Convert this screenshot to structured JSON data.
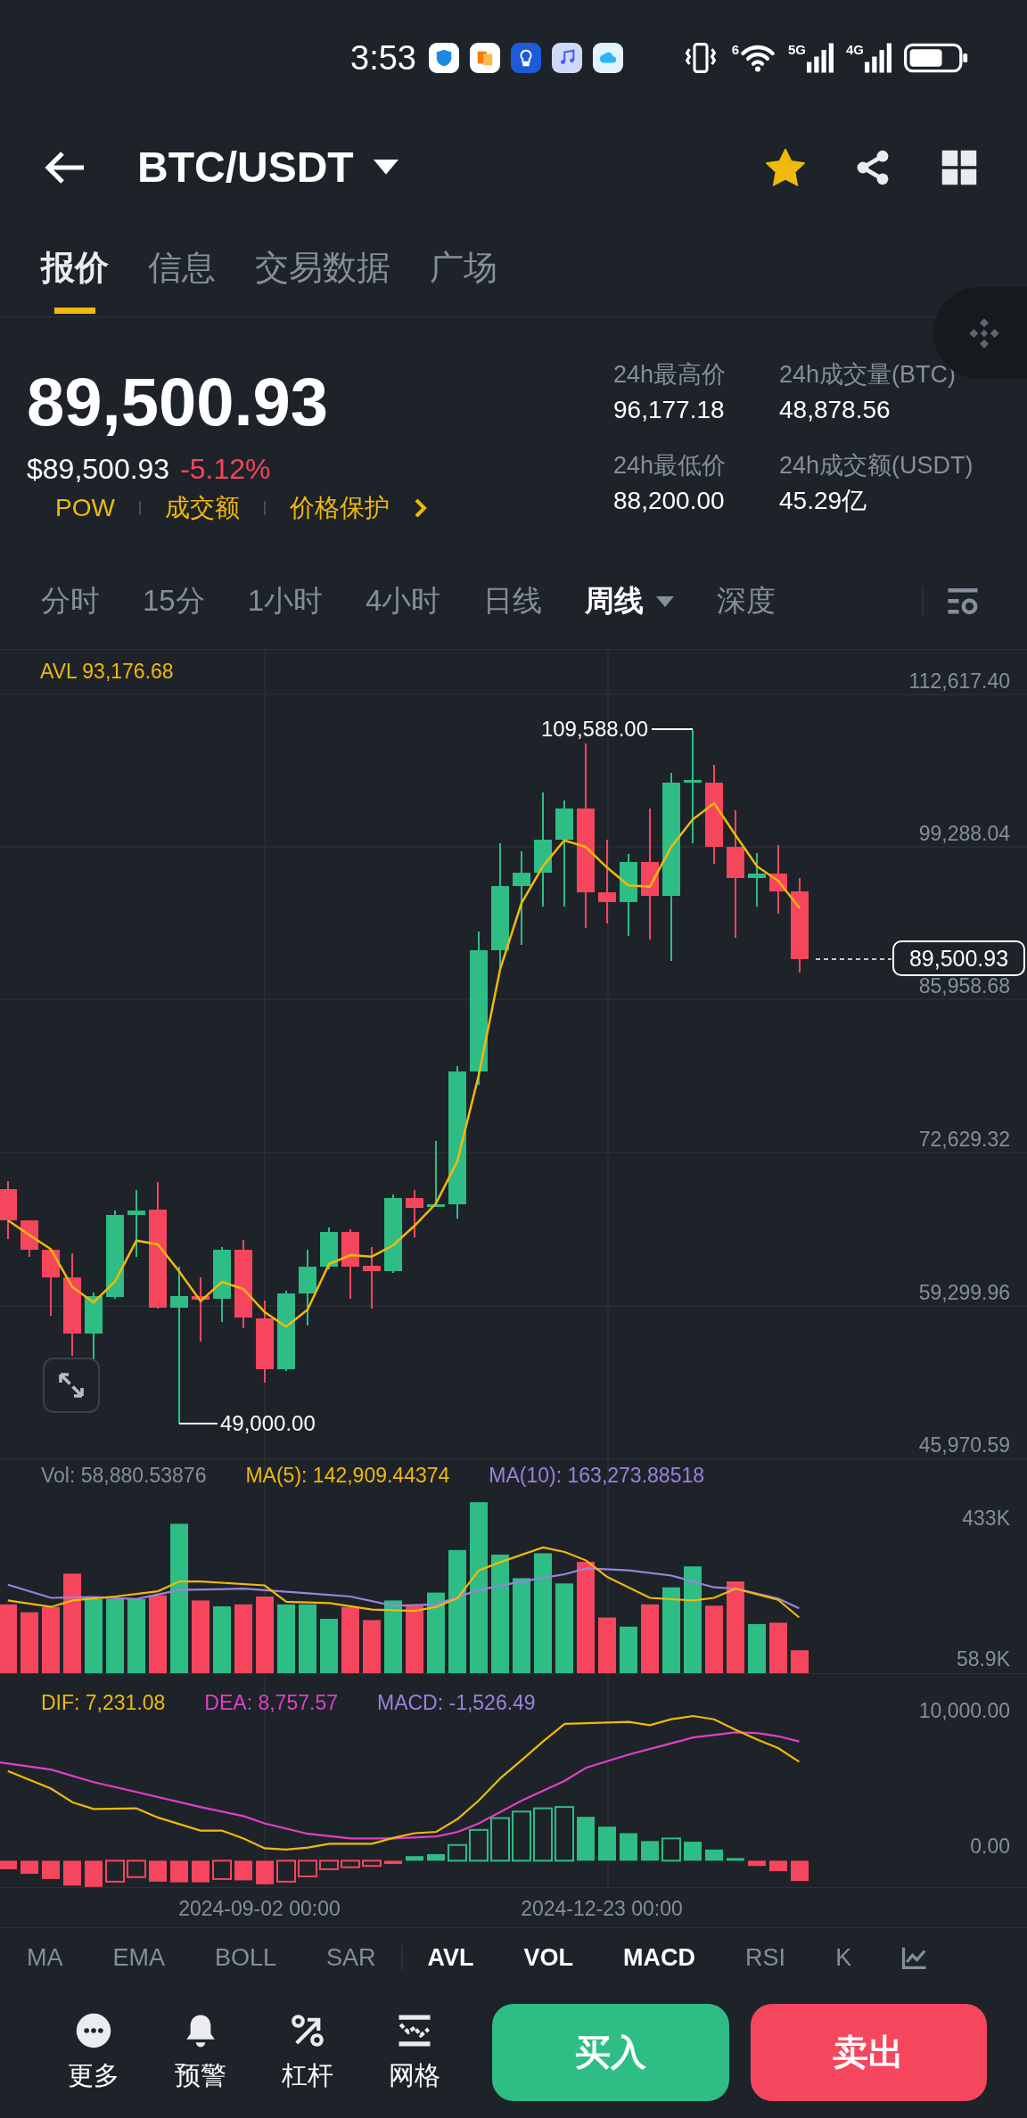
{
  "status_bar": {
    "time": "3:53",
    "wifi_label": "6",
    "network_1": "5G",
    "network_2": "4G"
  },
  "header": {
    "pair": "BTC/USDT",
    "favorite": true
  },
  "tabs": [
    {
      "label": "报价",
      "selected": true
    },
    {
      "label": "信息",
      "selected": false
    },
    {
      "label": "交易数据",
      "selected": false
    },
    {
      "label": "广场",
      "selected": false
    }
  ],
  "ticker": {
    "price": "89,500.93",
    "price_usd": "$89,500.93",
    "change": "-5.12%",
    "tags": [
      "POW",
      "成交额",
      "价格保护"
    ]
  },
  "stats": [
    {
      "label": "24h最高价",
      "value": "96,177.18"
    },
    {
      "label": "24h成交量(BTC)",
      "value": "48,878.56"
    },
    {
      "label": "24h最低价",
      "value": "88,200.00"
    },
    {
      "label": "24h成交额(USDT)",
      "value": "45.29亿"
    }
  ],
  "intervals": [
    {
      "label": "分时",
      "selected": false,
      "dropdown": false
    },
    {
      "label": "15分",
      "selected": false,
      "dropdown": false
    },
    {
      "label": "1小时",
      "selected": false,
      "dropdown": false
    },
    {
      "label": "4小时",
      "selected": false,
      "dropdown": false
    },
    {
      "label": "日线",
      "selected": false,
      "dropdown": false
    },
    {
      "label": "周线",
      "selected": true,
      "dropdown": true
    },
    {
      "label": "深度",
      "selected": false,
      "dropdown": false
    }
  ],
  "main_chart": {
    "indicator": "AVL 93,176.68",
    "y_labels": [
      "112,617.40",
      "99,288.04",
      "85,958.68",
      "72,629.32",
      "59,299.96",
      "45,970.59"
    ],
    "high_marker": "109,588.00",
    "low_marker": "49,000.00",
    "last_price": "89,500.93"
  },
  "volume_panel": {
    "legend": [
      "Vol: 58,880.53876",
      "MA(5): 142,909.44374",
      "MA(10): 163,273.88518"
    ],
    "y_labels": [
      "433K",
      "58.9K"
    ]
  },
  "macd_panel": {
    "legend": [
      "DIF: 7,231.08",
      "DEA: 8,757.57",
      "MACD: -1,526.49"
    ],
    "y_labels": [
      "10,000.00",
      "0.00"
    ]
  },
  "x_labels": [
    "2024-09-02 00:00",
    "2024-12-23 00:00"
  ],
  "indicators": [
    {
      "label": "MA",
      "selected": false
    },
    {
      "label": "EMA",
      "selected": false
    },
    {
      "label": "BOLL",
      "selected": false
    },
    {
      "label": "SAR",
      "selected": false
    },
    {
      "label": "AVL",
      "selected": true
    },
    {
      "label": "VOL",
      "selected": true
    },
    {
      "label": "MACD",
      "selected": true
    },
    {
      "label": "RSI",
      "selected": false
    },
    {
      "label": "K",
      "selected": false
    }
  ],
  "toolbar": [
    {
      "label": "更多",
      "kind": "more"
    },
    {
      "label": "预警",
      "kind": "alert"
    },
    {
      "label": "杠杆",
      "kind": "leverage"
    },
    {
      "label": "网格",
      "kind": "grid"
    }
  ],
  "actions": [
    {
      "label": "买入",
      "kind": "buy"
    },
    {
      "label": "卖出",
      "kind": "sell"
    }
  ]
}
